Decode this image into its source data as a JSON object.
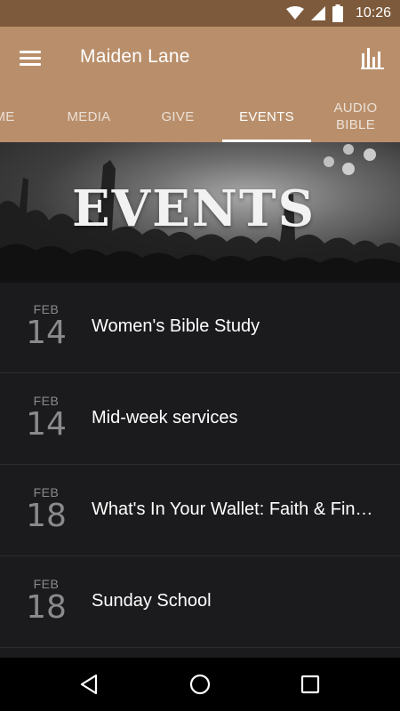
{
  "status_bar": {
    "time": "10:26",
    "icons": [
      "wifi-icon",
      "cell-signal-icon",
      "battery-icon"
    ]
  },
  "app_bar": {
    "title": "Maiden Lane",
    "left_icon": "menu-icon",
    "right_icon": "bar-chart-icon",
    "background": "#b98f6b"
  },
  "tabs": [
    {
      "label": "ME",
      "active": false
    },
    {
      "label": "MEDIA",
      "active": false
    },
    {
      "label": "GIVE",
      "active": false
    },
    {
      "label": "EVENTS",
      "active": true
    },
    {
      "label": "AUDIO\nBIBLE",
      "active": false
    }
  ],
  "hero": {
    "title": "EVENTS"
  },
  "events": [
    {
      "month": "FEB",
      "day": "14",
      "title": "Women's Bible Study"
    },
    {
      "month": "FEB",
      "day": "14",
      "title": "Mid-week services"
    },
    {
      "month": "FEB",
      "day": "18",
      "title": "What's In Your Wallet: Faith & Fin…"
    },
    {
      "month": "FEB",
      "day": "18",
      "title": "Sunday School"
    }
  ],
  "nav_bar": {
    "buttons": [
      "back-icon",
      "home-icon",
      "recents-icon"
    ]
  }
}
